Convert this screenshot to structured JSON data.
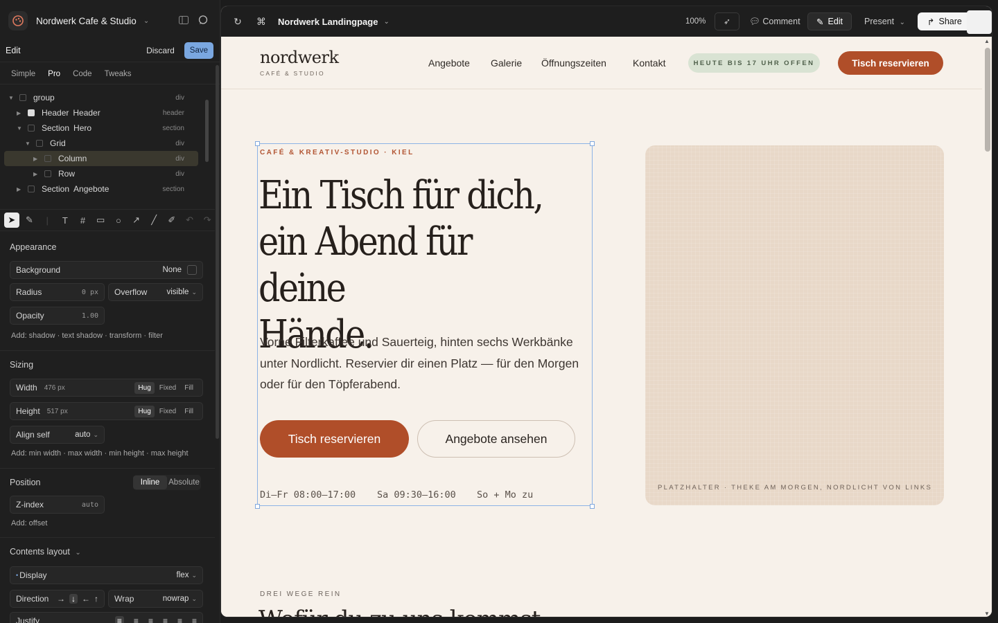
{
  "app": {
    "project_name": "Nordwerk Cafe & Studio",
    "edit_label": "Edit",
    "discard_label": "Discard",
    "save_label": "Save",
    "modes": [
      "Simple",
      "Pro",
      "Code",
      "Tweaks"
    ],
    "active_mode": "Pro"
  },
  "layers": [
    {
      "name": "group",
      "label": "",
      "tag": "div",
      "depth": 0,
      "expanded": true
    },
    {
      "name": "Header",
      "label": "Header",
      "tag": "header",
      "depth": 1,
      "expanded": false
    },
    {
      "name": "Section",
      "label": "Hero",
      "tag": "section",
      "depth": 1,
      "expanded": true
    },
    {
      "name": "Grid",
      "label": "",
      "tag": "div",
      "depth": 2,
      "expanded": true
    },
    {
      "name": "Column",
      "label": "",
      "tag": "div",
      "depth": 3,
      "selected": true
    },
    {
      "name": "Row",
      "label": "",
      "tag": "div",
      "depth": 3
    },
    {
      "name": "Section",
      "label": "Angebote",
      "tag": "section",
      "depth": 1
    }
  ],
  "inspector": {
    "appearance": {
      "title": "Appearance",
      "background_label": "Background",
      "background_value": "None",
      "radius_label": "Radius",
      "radius_value": "0 px",
      "overflow_label": "Overflow",
      "overflow_value": "visible",
      "opacity_label": "Opacity",
      "opacity_value": "1.00",
      "add_line": "Add: shadow · text shadow · transform · filter"
    },
    "sizing": {
      "title": "Sizing",
      "width_label": "Width",
      "width_value": "476 px",
      "height_label": "Height",
      "height_value": "517 px",
      "modes": [
        "Hug",
        "Fixed",
        "Fill"
      ],
      "align_label": "Align self",
      "align_value": "auto",
      "add_line": "Add: min width · max width · min height · max height"
    },
    "position": {
      "title": "Position",
      "modes": [
        "Inline",
        "Absolute"
      ],
      "zindex_label": "Z-index",
      "zindex_value": "auto",
      "add_line": "Add: offset"
    },
    "layout": {
      "title": "Contents layout",
      "display_label": "Display",
      "display_value": "flex",
      "direction_label": "Direction",
      "wrap_label": "Wrap",
      "wrap_value": "nowrap",
      "justify_label": "Justify"
    }
  },
  "canvas": {
    "title": "Nordwerk Landingpage",
    "zoom": "100%",
    "comment_label": "Comment",
    "edit_label": "Edit",
    "present_label": "Present",
    "share_label": "Share"
  },
  "site": {
    "brand_name": "nordwerk",
    "brand_sub": "CAFÉ & STUDIO",
    "nav": [
      "Angebote",
      "Galerie",
      "Öffnungszeiten",
      "Kontakt"
    ],
    "open_badge": "HEUTE BIS 17 UHR OFFEN",
    "nav_cta": "Tisch reservieren",
    "hero": {
      "eyebrow": "CAFÉ & KREATIV-STUDIO · KIEL",
      "headline_1": "Ein Tisch für dich,",
      "headline_2": "ein Abend für deine",
      "headline_3": "Hände.",
      "body": "Vorne Filterkaffee und Sauerteig, hinten sechs Werkbänke unter Nordlicht. Reservier dir einen Platz — für den Morgen oder für den Töpferabend.",
      "cta_primary": "Tisch reservieren",
      "cta_secondary": "Angebote ansehen",
      "hours": [
        "Di–Fr 08:00–17:00",
        "Sa 09:30–16:00",
        "So + Mo zu"
      ]
    },
    "placeholder_caption": "PLATZHALTER · THEKE AM MORGEN, NORDLICHT VON LINKS",
    "section2": {
      "eyebrow": "DREI WEGE REIN",
      "title": "Wofür du zu uns kommst"
    }
  },
  "colors": {
    "accent": "#b04e29",
    "page_bg": "#f7f1ea",
    "badge_bg": "#d9e3d3",
    "selection": "#8cb3e6"
  }
}
